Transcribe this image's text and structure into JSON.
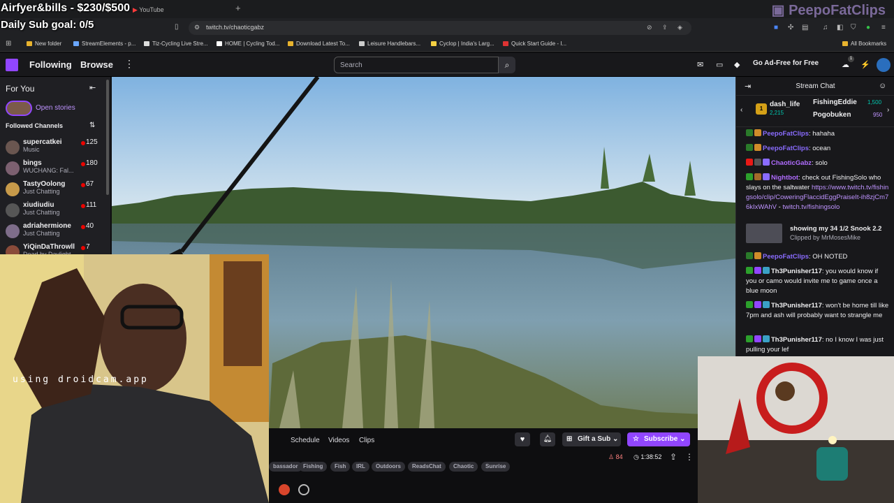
{
  "overlay": {
    "goal_line1": "Airfyer&bills - $230/$500",
    "goal_line2": "Daily Sub goal: 0/5",
    "brand": "PeepoFatClips",
    "webcam_watermark": "using droidcam.app"
  },
  "browser": {
    "tab_label": "YouTube",
    "url": "twitch.tv/chaoticgabz",
    "bookmarks": [
      "New folder",
      "StreamElements - p...",
      "Tiz-Cycling Live Stre...",
      "HOME | Cycling Tod...",
      "Download Latest To...",
      "Leisure Handlebars...",
      "Cyclop | India's Larg...",
      "Quick Start Guide - I..."
    ],
    "all_bookmarks": "All Bookmarks"
  },
  "twitch_header": {
    "following": "Following",
    "browse": "Browse",
    "search_placeholder": "Search",
    "ad_free": "Go Ad-Free for Free",
    "notification_count": "1"
  },
  "sidebar": {
    "title": "For You",
    "stories_link": "Open stories",
    "section": "Followed Channels",
    "channels": [
      {
        "name": "supercatkei",
        "category": "Music",
        "viewers": "125"
      },
      {
        "name": "bings",
        "category": "WUCHANG: Fal...",
        "viewers": "180"
      },
      {
        "name": "TastyOolong",
        "category": "Just Chatting",
        "viewers": "67"
      },
      {
        "name": "xiudiudiu",
        "category": "Just Chatting",
        "viewers": "111"
      },
      {
        "name": "adriahermione",
        "category": "Just Chatting",
        "viewers": "40"
      },
      {
        "name": "YiQinDaThrowll",
        "category": "Dead by Daylight",
        "viewers": "7"
      }
    ]
  },
  "stream_info": {
    "tabs": [
      "Schedule",
      "Videos",
      "Clips"
    ],
    "gift_sub": "Gift a Sub",
    "subscribe": "Subscribe",
    "viewer_count": "84",
    "uptime": "1:38:52",
    "tags": [
      "bassador",
      "Fishing",
      "Fish",
      "IRL",
      "Outdoors",
      "ReadsChat",
      "Chaotic",
      "Sunrise"
    ]
  },
  "chat": {
    "title": "Stream Chat",
    "leaderboard": {
      "first": {
        "name": "dash_life",
        "points": "2,215"
      },
      "second": {
        "name": "FishingEddie",
        "points": "1,500"
      },
      "third": {
        "name": "Pogobuken",
        "points": "950"
      }
    },
    "messages": [
      {
        "user": "PeepoFatClips",
        "text": ": hahaha"
      },
      {
        "user": "PeepoFatClips",
        "text": ": ocean"
      },
      {
        "user": "ChaoticGabz",
        "text": ": solo"
      },
      {
        "user": "Nightbot",
        "text": ": check out FishingSolo who slays on the saltwater ",
        "link": "https://www.twitch.tv/fishingsolo/clip/CoweringFlaccidEggPraiseIt-ih8zjCm76kIxWAhV",
        "link_tail": " - ",
        "link2": "twitch.tv/fishingsolo"
      },
      {
        "user": "PeepoFatClips",
        "text": ": OH NOTED"
      },
      {
        "user": "Th3Punisher117",
        "text": ": you would know if you or camo would invite me to game once a blue moon"
      },
      {
        "user": "Th3Punisher117",
        "text": ": won't be home till like 7pm and ash will probably want to strangle me"
      },
      {
        "user": "Th3Punisher117",
        "text": ": no I know I was just pulling your lef"
      }
    ],
    "clip": {
      "title": "showing my 34 1/2 Snook 2.2",
      "by": "Clipped by MrMosesMike"
    }
  }
}
